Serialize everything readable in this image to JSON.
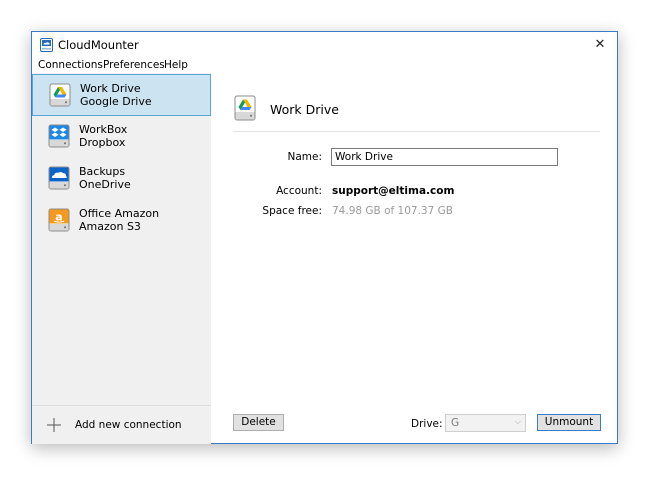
{
  "window": {
    "title": "CloudMounter",
    "close_glyph": "✕",
    "app_icon": "cloudmounter-icon"
  },
  "menu": [
    "Connections",
    "Preferences",
    "Help"
  ],
  "sidebar": {
    "items": [
      {
        "name": "Work Drive",
        "service": "Google Drive",
        "icon": "google-drive-icon",
        "selected": true
      },
      {
        "name": "WorkBox",
        "service": "Dropbox",
        "icon": "dropbox-icon",
        "selected": false
      },
      {
        "name": "Backups",
        "service": "OneDrive",
        "icon": "onedrive-icon",
        "selected": false
      },
      {
        "name": "Office Amazon",
        "service": "Amazon S3",
        "icon": "amazon-s3-icon",
        "selected": false
      }
    ],
    "add_label": "Add new connection"
  },
  "details": {
    "title": "Work Drive",
    "name_label": "Name:",
    "name_value": "Work Drive",
    "account_label": "Account:",
    "account_value": "support@eltima.com",
    "space_label": "Space free:",
    "space_value": "74.98 GB of 107.37 GB"
  },
  "footer": {
    "delete_label": "Delete",
    "drive_label": "Drive:",
    "drive_value": "G",
    "unmount_label": "Unmount"
  },
  "colors": {
    "accent": "#3a7cc9",
    "selected_bg": "#cce4f1",
    "selected_border": "#5ba4d6",
    "sidebar_bg": "#f0f0f0",
    "google_green": "#0f9d58",
    "google_yellow": "#f4b400",
    "google_blue": "#4285f4",
    "dropbox_blue": "#1e88e5",
    "onedrive_blue": "#0b64c8",
    "amazon_orange": "#f39a1e"
  }
}
